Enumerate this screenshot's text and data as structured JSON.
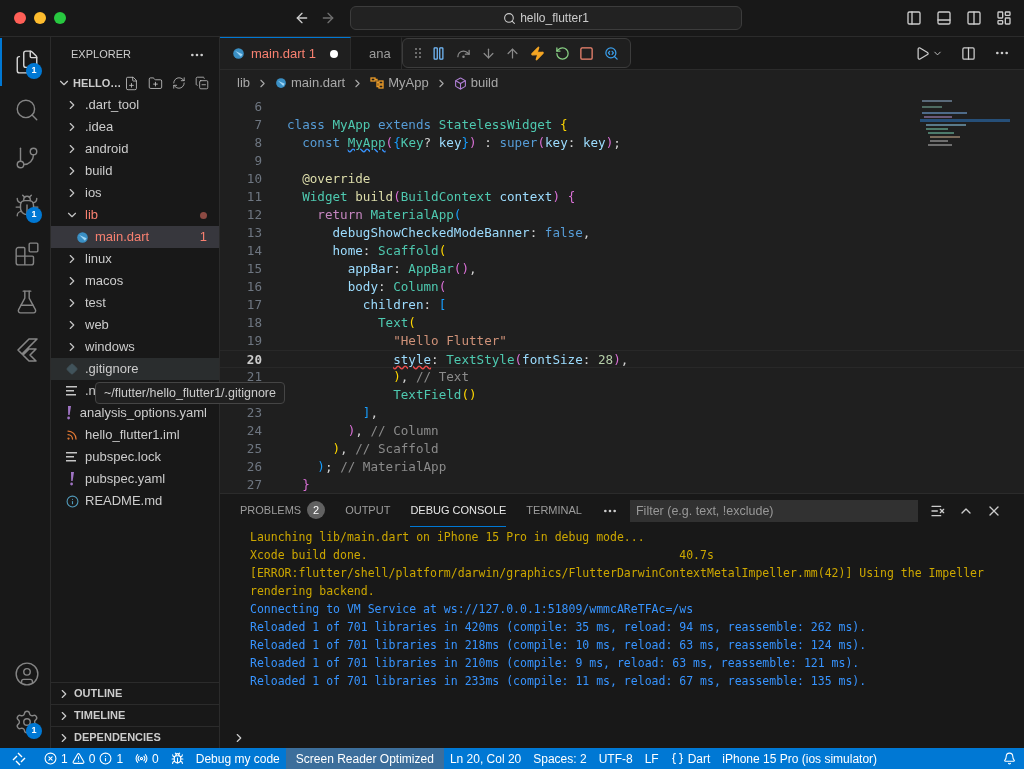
{
  "window": {
    "title": "hello_flutter1"
  },
  "activity_bar": {
    "items": [
      {
        "kind": "explorer",
        "selected": true,
        "badge": "1"
      },
      {
        "kind": "search",
        "selected": false
      },
      {
        "kind": "source-control",
        "selected": false
      },
      {
        "kind": "run-debug",
        "selected": false,
        "badge": "1"
      },
      {
        "kind": "extensions",
        "selected": false
      },
      {
        "kind": "testing",
        "selected": false
      },
      {
        "kind": "flutter",
        "selected": false
      }
    ],
    "bottom": [
      {
        "kind": "account"
      },
      {
        "kind": "settings",
        "badge": "1"
      }
    ]
  },
  "sidebar": {
    "title": "EXPLORER",
    "project": {
      "name": "HELLO…",
      "expanded": true
    },
    "tree": [
      {
        "name": ".dart_tool",
        "kind": "folder",
        "expanded": false,
        "selected": false
      },
      {
        "name": ".idea",
        "kind": "folder",
        "expanded": false,
        "selected": false
      },
      {
        "name": "android",
        "kind": "folder",
        "expanded": false,
        "selected": false
      },
      {
        "name": "build",
        "kind": "folder",
        "expanded": false,
        "selected": false
      },
      {
        "name": "ios",
        "kind": "folder",
        "expanded": false,
        "selected": false
      },
      {
        "name": "lib",
        "kind": "folder",
        "expanded": true,
        "selected": false,
        "error": true,
        "children": [
          {
            "name": "main.dart",
            "kind": "dart",
            "selected": true,
            "error": true,
            "problems": "1"
          }
        ]
      },
      {
        "name": "linux",
        "kind": "folder",
        "expanded": false,
        "selected": false
      },
      {
        "name": "macos",
        "kind": "folder",
        "expanded": false,
        "selected": false
      },
      {
        "name": "test",
        "kind": "folder",
        "expanded": false,
        "selected": false
      },
      {
        "name": "web",
        "kind": "folder",
        "expanded": false,
        "selected": false
      },
      {
        "name": "windows",
        "kind": "folder",
        "expanded": false,
        "selected": false
      },
      {
        "name": ".gitignore",
        "kind": "git",
        "selected": false,
        "hovered": true
      },
      {
        "name": ".n",
        "kind": "lines",
        "selected": false
      },
      {
        "name": "analysis_options.yaml",
        "kind": "yaml",
        "selected": false
      },
      {
        "name": "hello_flutter1.iml",
        "kind": "rss",
        "selected": false
      },
      {
        "name": "pubspec.lock",
        "kind": "lines",
        "selected": false
      },
      {
        "name": "pubspec.yaml",
        "kind": "yaml",
        "selected": false
      },
      {
        "name": "README.md",
        "kind": "info",
        "selected": false
      }
    ],
    "sections": [
      {
        "title": "OUTLINE",
        "expanded": false
      },
      {
        "title": "TIMELINE",
        "expanded": false
      },
      {
        "title": "DEPENDENCIES",
        "expanded": false
      }
    ]
  },
  "tooltip": {
    "text": "~/flutter/hello_flutter1/.gitignore"
  },
  "editor": {
    "tabs": [
      {
        "label": "main.dart",
        "kind": "dart",
        "problems": "1",
        "modified": true,
        "error": true,
        "selected": true
      },
      {
        "label": "ana",
        "kind": "yaml",
        "selected": false
      }
    ],
    "breadcrumb": [
      {
        "text": "lib",
        "kind": "folder"
      },
      {
        "text": "main.dart",
        "kind": "dart"
      },
      {
        "text": "MyApp",
        "kind": "class"
      },
      {
        "text": "build",
        "kind": "method"
      }
    ],
    "debug_toolbar": [
      {
        "kind": "grip"
      },
      {
        "kind": "pause"
      },
      {
        "kind": "step-over"
      },
      {
        "kind": "step-into"
      },
      {
        "kind": "step-out"
      },
      {
        "kind": "hot-reload"
      },
      {
        "kind": "restart"
      },
      {
        "kind": "stop"
      },
      {
        "kind": "inspect"
      }
    ],
    "lines": [
      {
        "number": "6"
      },
      {
        "number": "7",
        "tokens": [
          {
            "text": "class",
            "kind": "kw"
          },
          {
            "text": " MyApp",
            "kind": "type"
          },
          {
            "text": " extends",
            "kind": "kw"
          },
          {
            "text": " StatelessWidget",
            "kind": "type"
          },
          {
            "text": " {",
            "kind": "b1"
          }
        ]
      },
      {
        "number": "8",
        "tokens": [
          {
            "text": "  const",
            "kind": "kw"
          },
          {
            "text": " MyApp",
            "kind": "type",
            "info": true
          },
          {
            "text": "(",
            "kind": "b2"
          },
          {
            "text": "{",
            "kind": "b3"
          },
          {
            "text": "Key",
            "kind": "type"
          },
          {
            "text": "?",
            "kind": "plain"
          },
          {
            "text": " key",
            "kind": "var"
          },
          {
            "text": "}",
            "kind": "b3"
          },
          {
            "text": ")",
            "kind": "b2"
          },
          {
            "text": " :",
            "kind": "plain"
          },
          {
            "text": " super",
            "kind": "kw"
          },
          {
            "text": "(",
            "kind": "b2"
          },
          {
            "text": "key",
            "kind": "var"
          },
          {
            "text": ":",
            "kind": "plain"
          },
          {
            "text": " key",
            "kind": "var"
          },
          {
            "text": ")",
            "kind": "b2"
          },
          {
            "text": ";",
            "kind": "plain"
          }
        ]
      },
      {
        "number": "9"
      },
      {
        "number": "10",
        "tokens": [
          {
            "text": "  @override",
            "kind": "fn"
          }
        ]
      },
      {
        "number": "11",
        "tokens": [
          {
            "text": "  Widget",
            "kind": "type"
          },
          {
            "text": " build",
            "kind": "fn"
          },
          {
            "text": "(",
            "kind": "b2"
          },
          {
            "text": "BuildContext",
            "kind": "type"
          },
          {
            "text": " context",
            "kind": "var"
          },
          {
            "text": ")",
            "kind": "b2"
          },
          {
            "text": " {",
            "kind": "b2"
          }
        ]
      },
      {
        "number": "12",
        "tokens": [
          {
            "text": "    return",
            "kind": "ctrl"
          },
          {
            "text": " MaterialApp",
            "kind": "type"
          },
          {
            "text": "(",
            "kind": "b3"
          }
        ]
      },
      {
        "number": "13",
        "tokens": [
          {
            "text": "      debugShowCheckedModeBanner",
            "kind": "var"
          },
          {
            "text": ":",
            "kind": "plain"
          },
          {
            "text": " false",
            "kind": "kw"
          },
          {
            "text": ",",
            "kind": "plain"
          }
        ]
      },
      {
        "number": "14",
        "tokens": [
          {
            "text": "      home",
            "kind": "var"
          },
          {
            "text": ":",
            "kind": "plain"
          },
          {
            "text": " Scaffold",
            "kind": "type"
          },
          {
            "text": "(",
            "kind": "b1"
          }
        ]
      },
      {
        "number": "15",
        "tokens": [
          {
            "text": "        appBar",
            "kind": "var"
          },
          {
            "text": ":",
            "kind": "plain"
          },
          {
            "text": " AppBar",
            "kind": "type"
          },
          {
            "text": "()",
            "kind": "b2"
          },
          {
            "text": ",",
            "kind": "plain"
          }
        ]
      },
      {
        "number": "16",
        "tokens": [
          {
            "text": "        body",
            "kind": "var"
          },
          {
            "text": ":",
            "kind": "plain"
          },
          {
            "text": " Column",
            "kind": "type"
          },
          {
            "text": "(",
            "kind": "b2"
          }
        ]
      },
      {
        "number": "17",
        "tokens": [
          {
            "text": "          children",
            "kind": "var"
          },
          {
            "text": ":",
            "kind": "plain"
          },
          {
            "text": " [",
            "kind": "b3"
          }
        ]
      },
      {
        "number": "18",
        "tokens": [
          {
            "text": "            Text",
            "kind": "type"
          },
          {
            "text": "(",
            "kind": "b1"
          }
        ]
      },
      {
        "number": "19",
        "tokens": [
          {
            "text": "              \"Hello Flutter\"",
            "kind": "str"
          }
        ]
      },
      {
        "number": "20",
        "current": true,
        "tokens": [
          {
            "text": "              style",
            "kind": "var",
            "error": true
          },
          {
            "text": ":",
            "kind": "plain"
          },
          {
            "text": " TextStyle",
            "kind": "type"
          },
          {
            "text": "(",
            "kind": "b2"
          },
          {
            "text": "fontSize",
            "kind": "var"
          },
          {
            "text": ":",
            "kind": "plain"
          },
          {
            "text": " 28",
            "kind": "num"
          },
          {
            "text": ")",
            "kind": "b2"
          },
          {
            "text": ",",
            "kind": "plain"
          }
        ]
      },
      {
        "number": "21",
        "tokens": [
          {
            "text": "              )",
            "kind": "b1"
          },
          {
            "text": ",",
            "kind": "plain"
          },
          {
            "text": " // Text",
            "kind": "hint"
          }
        ]
      },
      {
        "tokens": [
          {
            "text": "              TextField",
            "kind": "type"
          },
          {
            "text": "()",
            "kind": "b1"
          }
        ]
      },
      {
        "number": "23",
        "tokens": [
          {
            "text": "          ]",
            "kind": "b3"
          },
          {
            "text": ",",
            "kind": "plain"
          }
        ]
      },
      {
        "number": "24",
        "tokens": [
          {
            "text": "        )",
            "kind": "b2"
          },
          {
            "text": ",",
            "kind": "plain"
          },
          {
            "text": " // Column",
            "kind": "hint"
          }
        ]
      },
      {
        "number": "25",
        "tokens": [
          {
            "text": "      )",
            "kind": "b1"
          },
          {
            "text": ",",
            "kind": "plain"
          },
          {
            "text": " // Scaffold",
            "kind": "hint"
          }
        ]
      },
      {
        "number": "26",
        "tokens": [
          {
            "text": "    )",
            "kind": "b3"
          },
          {
            "text": ";",
            "kind": "plain"
          },
          {
            "text": " // MaterialApp",
            "kind": "hint"
          }
        ]
      },
      {
        "number": "27",
        "tokens": [
          {
            "text": "  }",
            "kind": "b2"
          }
        ]
      }
    ]
  },
  "panel": {
    "tabs": [
      {
        "label": "PROBLEMS",
        "badge": "2",
        "selected": false
      },
      {
        "label": "OUTPUT",
        "selected": false
      },
      {
        "label": "DEBUG CONSOLE",
        "selected": true
      },
      {
        "label": "TERMINAL",
        "selected": false
      }
    ],
    "filter": {
      "placeholder": "Filter (e.g. text, !exclude)"
    },
    "console": [
      {
        "text": "Launching lib/main.dart on iPhone 15 Pro in debug mode...",
        "kind": "warn"
      },
      {
        "text": "Xcode build done.                                             40.7s",
        "kind": "warn"
      },
      {
        "text": "[ERROR:flutter/shell/platform/darwin/graphics/FlutterDarwinContextMetalImpeller.mm(42)] Using the Impeller rendering backend.",
        "kind": "warn"
      },
      {
        "text": "Connecting to VM Service at ws://127.0.0.1:51809/wmmcAReTFAc=/ws",
        "kind": "info"
      },
      {
        "text": "Reloaded 1 of 701 libraries in 420ms (compile: 35 ms, reload: 94 ms, reassemble: 262 ms).",
        "kind": "info"
      },
      {
        "text": "Reloaded 1 of 701 libraries in 218ms (compile: 10 ms, reload: 63 ms, reassemble: 124 ms).",
        "kind": "info"
      },
      {
        "text": "Reloaded 1 of 701 libraries in 210ms (compile: 9 ms, reload: 63 ms, reassemble: 121 ms).",
        "kind": "info"
      },
      {
        "text": "Reloaded 1 of 701 libraries in 233ms (compile: 11 ms, reload: 67 ms, reassemble: 135 ms).",
        "kind": "info"
      }
    ]
  },
  "status_bar": [
    {
      "kind": "remote"
    },
    {
      "kind": "problems",
      "errors": "1",
      "warnings": "0",
      "infos": "1"
    },
    {
      "kind": "ports",
      "text": "0"
    },
    {
      "kind": "debug",
      "text": "Debug my code"
    },
    {
      "kind": "plain",
      "text": "Screen Reader Optimized",
      "highlighted": true
    },
    {
      "kind": "plain",
      "text": "Ln 20, Col 20"
    },
    {
      "kind": "plain",
      "text": "Spaces: 2"
    },
    {
      "kind": "plain",
      "text": "UTF-8"
    },
    {
      "kind": "plain",
      "text": "LF"
    },
    {
      "kind": "language",
      "text": "Dart"
    },
    {
      "kind": "plain",
      "text": "iPhone 15 Pro (ios simulator)"
    },
    {
      "kind": "bell"
    }
  ]
}
